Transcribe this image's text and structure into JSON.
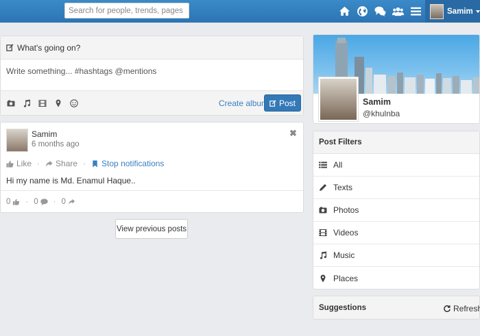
{
  "header": {
    "search_placeholder": "Search for people, trends, pages and ...",
    "icons": [
      "home-icon",
      "globe-icon",
      "chat-icon",
      "users-icon",
      "menu-icon"
    ],
    "user_name": "Samim",
    "brand_color": "#2c74b3"
  },
  "composer": {
    "title": "What's going on?",
    "placeholder": "Write something... #hashtags @mentions",
    "media_icons": [
      "camera-icon",
      "music-icon",
      "film-icon",
      "location-icon",
      "smile-icon"
    ],
    "create_album_label": "Create album",
    "post_label": "Post"
  },
  "post": {
    "author": "Samim",
    "time": "6 months ago",
    "like_label": "Like",
    "share_label": "Share",
    "stop_notifications_label": "Stop notifications",
    "text": "Hi my name is Md. Enamul Haque..",
    "likes_count": "0",
    "comments_count": "0",
    "shares_count": "0"
  },
  "view_previous_label": "View previous posts",
  "profile": {
    "name": "Samim",
    "handle": "@khulnba"
  },
  "filters": {
    "title": "Post Filters",
    "items": [
      {
        "label": "All",
        "icon": "list-icon"
      },
      {
        "label": "Texts",
        "icon": "pencil-icon"
      },
      {
        "label": "Photos",
        "icon": "photo-icon"
      },
      {
        "label": "Videos",
        "icon": "film-icon"
      },
      {
        "label": "Music",
        "icon": "music-icon"
      },
      {
        "label": "Places",
        "icon": "location-icon"
      }
    ]
  },
  "suggestions": {
    "title": "Suggestions",
    "refresh_label": "Refresh"
  }
}
